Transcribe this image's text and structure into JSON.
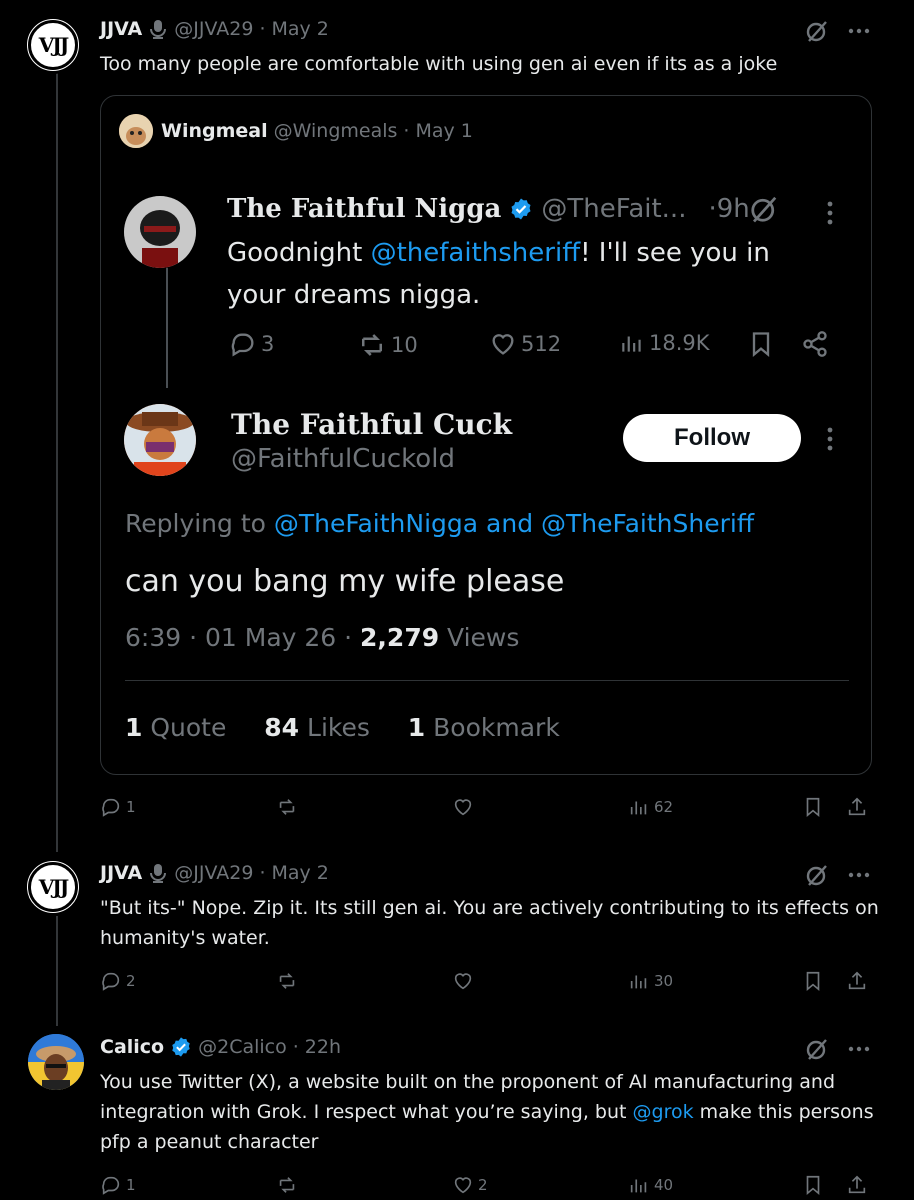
{
  "post1": {
    "name": "JJVA",
    "handle": "@JJVA29",
    "sep": "·",
    "date": "May 2",
    "text": "Too many people are comfortable with using gen ai even if its as a joke",
    "replies": "1",
    "views": "62",
    "avatar_text": "VJJ"
  },
  "quote": {
    "name": "Wingmeal",
    "handle": "@Wingmeals",
    "sep": "·",
    "date": "May 1",
    "inner_post": {
      "name": "The Faithful Nigga",
      "handle": "@TheFait...",
      "time": "·9h",
      "text_before": "Goodnight ",
      "mention": "@thefaithsheriff",
      "text_after": "! I'll see you in your dreams nigga.",
      "replies": "3",
      "reposts": "10",
      "likes": "512",
      "views": "18.9K"
    },
    "reply_post": {
      "name": "The Faithful Cuck",
      "handle": "@FaithfulCuckold",
      "follow_label": "Follow",
      "replying_to_prefix": "Replying to ",
      "replying_to_1": "@TheFaithNigga",
      "replying_and": " and ",
      "replying_to_2": "@TheFaithSheriff",
      "text": "can you bang my wife please",
      "time": "6:39",
      "date": "01 May 26",
      "views_count": "2,279",
      "views_label": " Views",
      "dot": " · ",
      "quotes_count": "1",
      "quotes_label": " Quote",
      "likes_count": "84",
      "likes_label": " Likes",
      "bookmarks_count": "1",
      "bookmarks_label": " Bookmark"
    }
  },
  "post2": {
    "name": "JJVA",
    "handle": "@JJVA29",
    "sep": "·",
    "date": "May 2",
    "text": "\"But its-\" Nope. Zip it. Its still gen ai. You are actively contributing to its effects on humanity's water.",
    "replies": "2",
    "views": "30",
    "avatar_text": "VJJ"
  },
  "post3": {
    "name": "Calico",
    "handle": "@2Calico",
    "sep": "·",
    "date": "22h",
    "text_before": "You use Twitter (X), a website built on the proponent of AI manufacturing and integration with Grok. I respect what you’re saying, but ",
    "mention": "@grok",
    "text_after": " make this persons pfp a peanut character",
    "replies": "1",
    "likes": "2",
    "views": "40"
  },
  "colors": {
    "background": "#000000",
    "text": "#e7e9ea",
    "muted": "#71767b",
    "link": "#1d9bf0",
    "border": "#2f3336",
    "verified": "#1d9bf0"
  }
}
